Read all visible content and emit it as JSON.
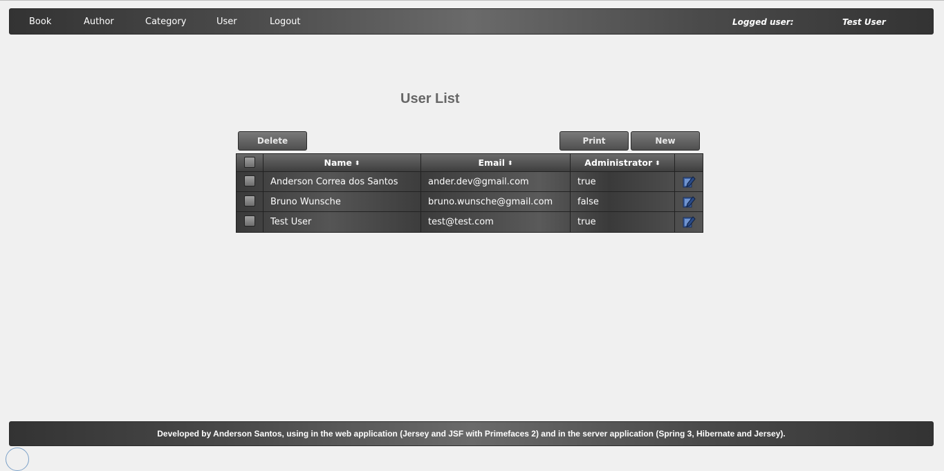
{
  "menu": {
    "items": [
      "Book",
      "Author",
      "Category",
      "User",
      "Logout"
    ],
    "logged_label": "Logged user:",
    "logged_user": "Test User"
  },
  "page": {
    "title": "User List"
  },
  "toolbar": {
    "delete_label": "Delete",
    "print_label": "Print",
    "new_label": "New"
  },
  "table": {
    "headers": [
      "Name",
      "Email",
      "Administrator"
    ],
    "rows": [
      {
        "name": "Anderson Correa dos Santos",
        "email": "ander.dev@gmail.com",
        "admin": "true"
      },
      {
        "name": "Bruno Wunsche",
        "email": "bruno.wunsche@gmail.com",
        "admin": "false"
      },
      {
        "name": "Test User",
        "email": "test@test.com",
        "admin": "true"
      }
    ]
  },
  "footer": {
    "text": "Developed by Anderson Santos, using in the web application (Jersey and JSF with Primefaces 2) and in the server application (Spring 3, Hibernate and Jersey)."
  },
  "icons": {
    "sort": "sort-icon",
    "edit": "edit-icon"
  },
  "colors": {
    "bar_dark": "#333333",
    "bar_mid": "#6a6a6a",
    "page_bg": "#f0f0f0",
    "title_gray": "#666666"
  }
}
